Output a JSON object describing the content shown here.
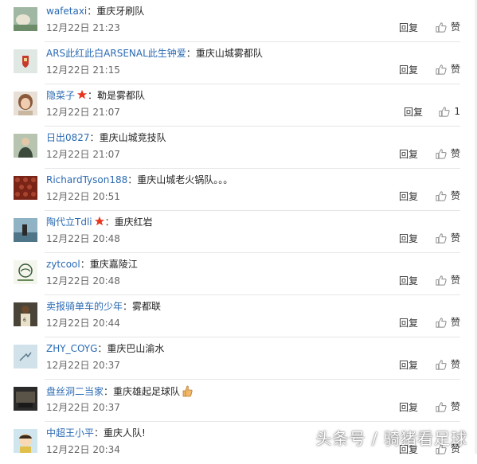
{
  "comments": [
    {
      "user": "wafetaxi",
      "text": "重庆牙刷队",
      "time": "12月22日 21:23",
      "reply": "回复",
      "like": "赞",
      "avatar": "wafetaxi-avatar"
    },
    {
      "user": "ARS此红此白ARSENAL此生钟爱",
      "text": "重庆山城雾都队",
      "time": "12月22日 21:15",
      "reply": "回复",
      "like": "赞",
      "avatar": "arsenal-avatar"
    },
    {
      "user": "隐菜子",
      "text": "勒是雾都队",
      "time": "12月22日 21:07",
      "reply": "回复",
      "like": "1",
      "avatar": "person-avatar",
      "star": true
    },
    {
      "user": "日出0827",
      "text": "重庆山城竞技队",
      "time": "12月22日 21:07",
      "reply": "回复",
      "like": "赞",
      "avatar": "person-avatar"
    },
    {
      "user": "RichardTyson188",
      "text": "重庆山城老火锅队。。。",
      "time": "12月22日 20:51",
      "reply": "回复",
      "like": "赞",
      "avatar": "red-pattern-avatar"
    },
    {
      "user": "陶代立Tdli",
      "text": "重庆红岩",
      "time": "12月22日 20:48",
      "reply": "回复",
      "like": "赞",
      "avatar": "lake-avatar",
      "star": true
    },
    {
      "user": "zytcool",
      "text": "重庆嘉陵江",
      "time": "12月22日 20:48",
      "reply": "回复",
      "like": "赞",
      "avatar": "logo-avatar"
    },
    {
      "user": "卖报骑单车的少年",
      "text": "雾都联",
      "time": "12月22日 20:44",
      "reply": "回复",
      "like": "赞",
      "avatar": "player-avatar"
    },
    {
      "user": "ZHY_COYG",
      "text": "重庆巴山渝水",
      "time": "12月22日 20:37",
      "reply": "回复",
      "like": "赞",
      "avatar": "sky-avatar"
    },
    {
      "user": "盘丝洞二当家",
      "text": "重庆雄起足球队",
      "time": "12月22日 20:37",
      "reply": "回复",
      "like": "赞",
      "avatar": "dark-avatar",
      "thumbs_emoji": true
    },
    {
      "user": "中超王小平",
      "text": "重庆人队!",
      "time": "12月22日 20:34",
      "reply": "回复",
      "like": "赞",
      "avatar": "cartoon-avatar"
    }
  ],
  "watermark": "头条号 / 骑猪看足球",
  "colors": {
    "username": "#2a6ab3",
    "star": "#e8341c",
    "separator": "#e6e6e6"
  }
}
